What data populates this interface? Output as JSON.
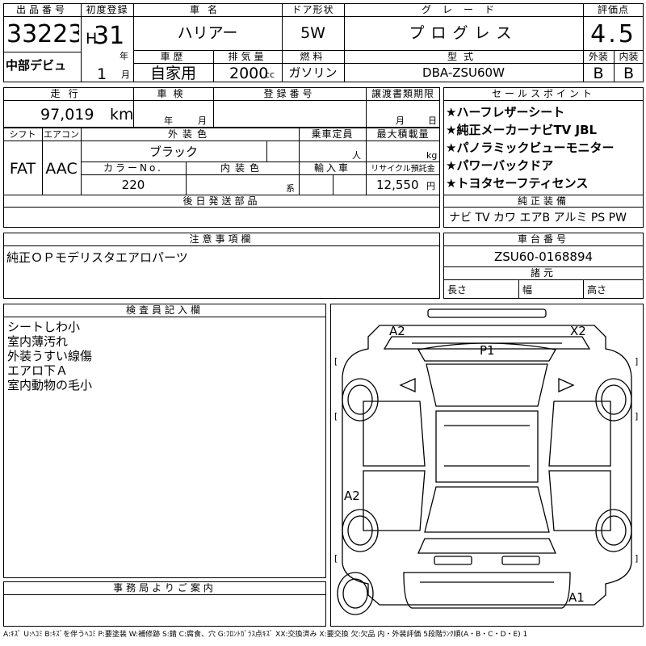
{
  "header": {
    "lot_label": "出品番号",
    "lot_number": "33223",
    "auction_name": "中部デビュ",
    "first_reg_label": "初度登録",
    "era": "H",
    "year": "31",
    "year_unit": "年",
    "month": "1",
    "month_unit": "月",
    "car_name_label": "車名",
    "car_name": "ハリアー",
    "door_label": "ドア形状",
    "door": "5W",
    "grade_label": "グレード",
    "grade": "プログレス",
    "score_label": "評価点",
    "score": "4.5",
    "history_label": "車歴",
    "history": "自家用",
    "displacement_label": "排気量",
    "displacement": "2000",
    "displacement_unit": "cc",
    "fuel_label": "燃料",
    "fuel": "ガソリン",
    "model_label": "型式",
    "model": "DBA-ZSU60W",
    "exterior_label": "外装",
    "interior_label": "内装",
    "exterior_grade": "B",
    "interior_grade": "B"
  },
  "row2": {
    "mileage_label": "走行",
    "mileage": "97,019",
    "mileage_unit": "km",
    "inspection_label": "車検",
    "year_unit": "年",
    "month_unit": "月",
    "reg_label": "登録番号",
    "transfer_label": "譲渡書類期限",
    "transfer_month": "月",
    "transfer_day": "日"
  },
  "row3": {
    "shift_label": "シフト",
    "shift": "FAT",
    "ac_label": "エアコン",
    "ac": "AAC",
    "ext_color_label": "外装色",
    "ext_color": "ブラック",
    "capacity_label": "乗車定員",
    "capacity_unit": "人",
    "load_label": "最大積載量",
    "load_unit": "kg",
    "color_no_label": "カラーNo.",
    "color_no": "220",
    "int_color_label": "内装色",
    "int_color_unit": "系",
    "import_label": "輸入車",
    "recycle_label": "リサイクル預託金",
    "recycle": "12,550",
    "recycle_unit": "円",
    "later_parts_label": "後日発送部品"
  },
  "sales": {
    "label": "セールスポイント",
    "items": [
      "★ハーフレザーシート",
      "★純正メーカーナビTV JBL",
      "★パノラミックビューモニター",
      "★パワーバックドア",
      "★トヨタセーフティセンス"
    ],
    "equipment_label": "純正装備",
    "equipment": "ナビ TV カワ エアB アルミ PS PW"
  },
  "notes": {
    "label": "注意事項欄",
    "text": "純正ＯＰモデリスタエアロパーツ"
  },
  "chassis": {
    "label": "車台番号",
    "number": "ZSU60-0168894",
    "dims_label": "諸元",
    "length_label": "長さ",
    "width_label": "幅",
    "height_label": "高さ"
  },
  "inspector": {
    "label": "検査員記入欄",
    "notes": "シートしわ小\n室内薄汚れ\n外装うすい線傷\nエアロ下Ａ\n室内動物の毛小"
  },
  "office": {
    "label": "事務局よりご案内"
  },
  "diagram": {
    "marks": [
      "A2",
      "X2",
      "P1",
      "A2",
      "A1"
    ],
    "brackets": [
      "[",
      "]",
      "[",
      "]",
      "[",
      "]"
    ]
  },
  "legend": "A:ｷｽﾞ U:ﾍｺﾐ B:ｷｽﾞを伴うﾍｺﾐ P:要塗装 W:補修跡 S:錆 C:腐食、穴 G:ﾌﾛﾝﾄｶﾞﾗｽ点ｷｽﾞ XX:交換済み X:要交換 欠:欠品 内・外装評価 5段階ﾗﾝｸ順(A・B・C・D・E) 1"
}
